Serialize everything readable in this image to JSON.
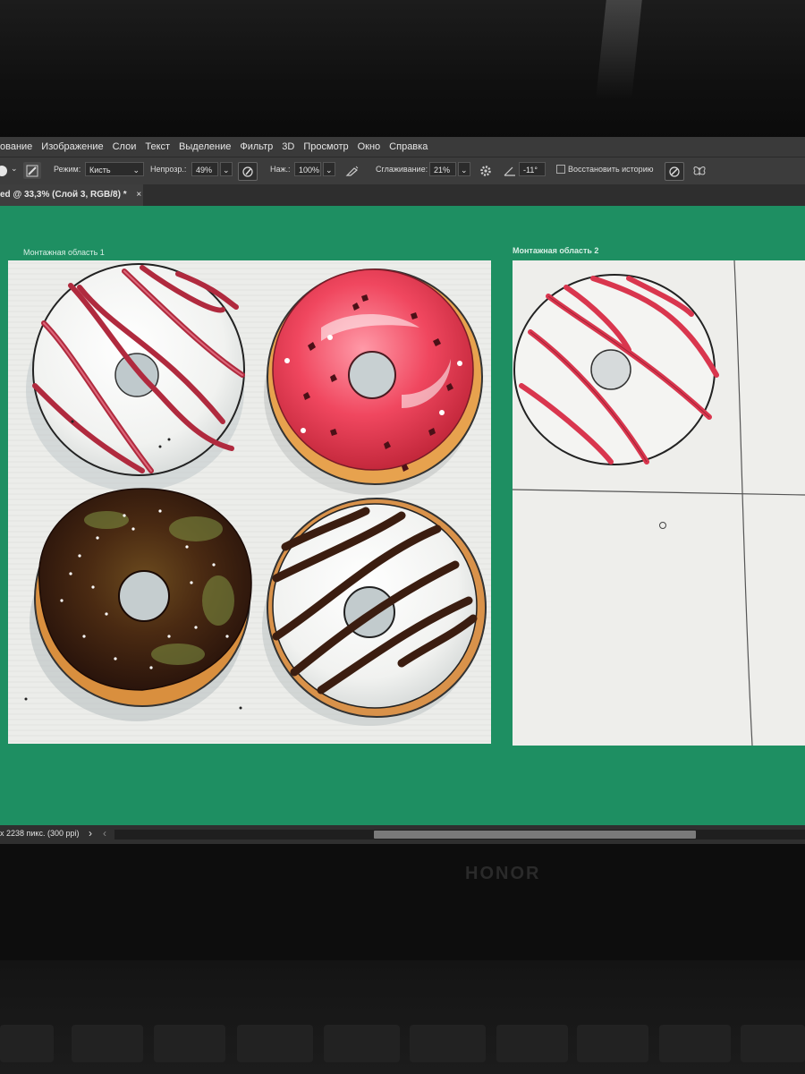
{
  "menu": [
    "ование",
    "Изображение",
    "Слои",
    "Текст",
    "Выделение",
    "Фильтр",
    "3D",
    "Просмотр",
    "Окно",
    "Справка"
  ],
  "options": {
    "mode_label": "Режим:",
    "mode_value": "Кисть",
    "opacity_label": "Непрозр.:",
    "opacity_value": "49%",
    "pressure_label": "Наж.:",
    "pressure_value": "100%",
    "smoothing_label": "Сглаживание:",
    "smoothing_value": "21%",
    "angle_value": "-11°",
    "restore_history_label": "Восстановить историю"
  },
  "document_tab": {
    "title": "ed @ 33,3% (Слой 3, RGB/8) *",
    "close": "×"
  },
  "artboards": {
    "label_1": "Монтажная область 1",
    "label_2": "Монтажная область 2"
  },
  "status": {
    "info": "x 2238 пикс. (300 ppi)",
    "arrow_right": "›",
    "arrow_left": "‹"
  },
  "laptop_brand": "HONOR",
  "colors": {
    "canvas_bg": "#1e8f62",
    "ui_dark": "#3c3c3c",
    "accent_glaze_pink": "#f04e68",
    "chocolate": "#3b1d10"
  }
}
